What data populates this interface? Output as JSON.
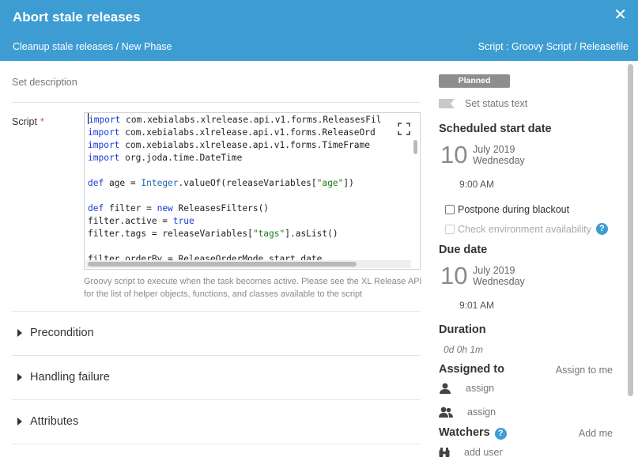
{
  "header": {
    "title": "Abort stale releases",
    "breadcrumb": "Cleanup stale releases / New Phase",
    "script_type": "Script : Groovy Script / Releasefile",
    "close_icon": "close-icon",
    "bg_color": "#3d9dd3"
  },
  "main": {
    "set_description": "Set description",
    "script_label": "Script",
    "required_mark": "*",
    "script_lines": [
      "import com.xebialabs.xlrelease.api.v1.forms.ReleasesFil",
      "import com.xebialabs.xlrelease.api.v1.forms.ReleaseOrd",
      "import com.xebialabs.xlrelease.api.v1.forms.TimeFrame",
      "import org.joda.time.DateTime",
      "",
      "def age = Integer.valueOf(releaseVariables[\"age\"])",
      "",
      "def filter = new ReleasesFilters()",
      "filter.active = true",
      "filter.tags = releaseVariables[\"tags\"].asList()",
      "",
      "filter.orderBy = ReleaseOrderMode.start_date"
    ],
    "hint": "Groovy script to execute when the task becomes active. Please see the XL Release API for the list of helper objects, functions, and classes available to the script",
    "sections": [
      {
        "label": "Precondition"
      },
      {
        "label": "Handling failure"
      },
      {
        "label": "Attributes"
      }
    ]
  },
  "side": {
    "status_badge": "Planned",
    "set_status_text": "Set status text",
    "scheduled_start": {
      "heading": "Scheduled start date",
      "day": "10",
      "month_year": "July 2019",
      "weekday": "Wednesday",
      "time": "9:00 AM"
    },
    "postpone_label": "Postpone during blackout",
    "check_env_label": "Check environment availability",
    "due": {
      "heading": "Due date",
      "day": "10",
      "month_year": "July 2019",
      "weekday": "Wednesday",
      "time": "9:01 AM"
    },
    "duration": {
      "heading": "Duration",
      "value": "0d 0h 1m"
    },
    "assigned": {
      "heading": "Assigned to",
      "assign_me": "Assign to me",
      "user_placeholder": "assign",
      "team_placeholder": "assign"
    },
    "watchers": {
      "heading": "Watchers",
      "add_me": "Add me",
      "add_user": "add user"
    }
  }
}
